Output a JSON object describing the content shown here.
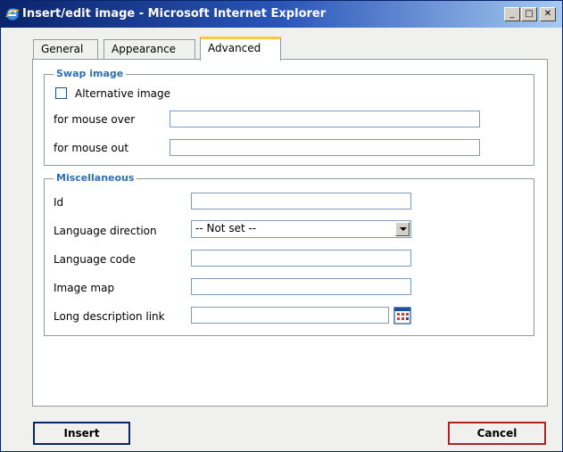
{
  "window": {
    "title": "Insert/edit image - Microsoft Internet Explorer",
    "minimize_glyph": "_",
    "maximize_glyph": "□",
    "close_glyph": "✕",
    "app_icon": "ie-icon"
  },
  "tabs": [
    {
      "label": "General",
      "active": false
    },
    {
      "label": "Appearance",
      "active": false
    },
    {
      "label": "Advanced",
      "active": true
    }
  ],
  "swap_image": {
    "legend": "Swap image",
    "alternative_image_label": "Alternative image",
    "alternative_image_checked": false,
    "mouse_over_label": "for mouse over",
    "mouse_over_value": "",
    "mouse_out_label": "for mouse out",
    "mouse_out_value": ""
  },
  "misc": {
    "legend": "Miscellaneous",
    "id_label": "Id",
    "id_value": "",
    "lang_dir_label": "Language direction",
    "lang_dir_value": "-- Not set --",
    "lang_code_label": "Language code",
    "lang_code_value": "",
    "image_map_label": "Image map",
    "image_map_value": "",
    "long_desc_label": "Long description link",
    "long_desc_value": "",
    "browse_icon": "browse-icon"
  },
  "buttons": {
    "insert": "Insert",
    "cancel": "Cancel"
  },
  "colors": {
    "titlebar_start": "#0a246a",
    "titlebar_end": "#a6caf0",
    "legend": "#2b6fb6",
    "active_tab_accent": "#ffc83c",
    "cancel_border": "#b22222"
  }
}
